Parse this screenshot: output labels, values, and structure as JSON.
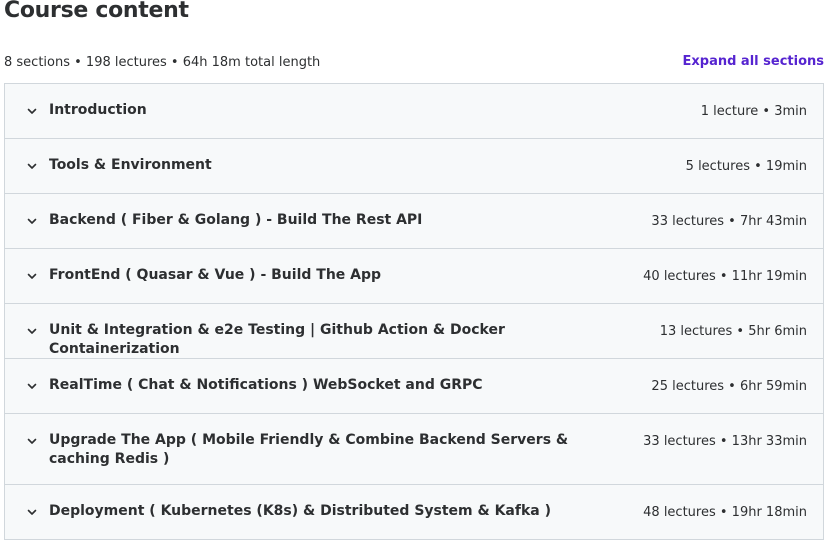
{
  "header": {
    "title": "Course content",
    "summary": "8 sections • 198 lectures • 64h 18m total length",
    "expand_label": "Expand all sections"
  },
  "colors": {
    "accent": "#5624d0",
    "text": "#2d2f31",
    "section_bg": "#f7f9fa",
    "border": "#d1d7dc"
  },
  "sections": [
    {
      "title": "Introduction",
      "meta": "1 lecture • 3min",
      "icon": "chevron-down-icon"
    },
    {
      "title": "Tools & Environment",
      "meta": "5 lectures • 19min",
      "icon": "chevron-down-icon"
    },
    {
      "title": "Backend ( Fiber & Golang ) - Build The Rest API",
      "meta": "33 lectures • 7hr 43min",
      "icon": "chevron-down-icon"
    },
    {
      "title": "FrontEnd ( Quasar & Vue ) - Build The App",
      "meta": "40 lectures • 11hr 19min",
      "icon": "chevron-down-icon"
    },
    {
      "title": "Unit & Integration & e2e Testing | Github Action & Docker Containerization",
      "meta": "13 lectures • 5hr 6min",
      "icon": "chevron-down-icon"
    },
    {
      "title": "RealTime ( Chat & Notifications ) WebSocket and GRPC",
      "meta": "25 lectures • 6hr 59min",
      "icon": "chevron-down-icon"
    },
    {
      "title": "Upgrade The App ( Mobile Friendly & Combine Backend Servers & caching Redis )",
      "meta": "33 lectures • 13hr 33min",
      "icon": "chevron-down-icon"
    },
    {
      "title": "Deployment ( Kubernetes (K8s) & Distributed System & Kafka )",
      "meta": "48 lectures • 19hr 18min",
      "icon": "chevron-down-icon"
    }
  ]
}
